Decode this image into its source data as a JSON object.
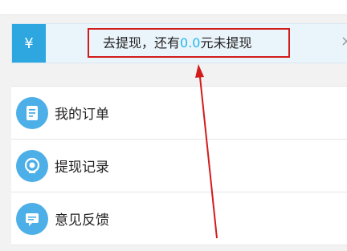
{
  "banner": {
    "icon": "yen-icon",
    "text_prefix": "去提现，还有",
    "amount": "0.0",
    "text_suffix": "元未提现",
    "close_glyph": "×"
  },
  "menu": {
    "items": [
      {
        "label": "我的订单",
        "icon": "order-list-icon"
      },
      {
        "label": "提现记录",
        "icon": "coin-icon"
      },
      {
        "label": "意见反馈",
        "icon": "message-icon"
      }
    ]
  },
  "colors": {
    "accent": "#2ea7e0",
    "amount": "#22b8ec",
    "highlight": "#d21c1c"
  }
}
